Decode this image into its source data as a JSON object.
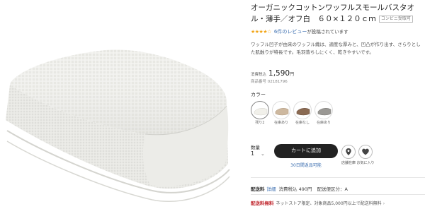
{
  "product": {
    "title": "オーガニックコットンワッフルスモールバスタオル・薄手／オフ白　６０×１２０ｃｍ",
    "conv_badge": "コンビニ受取可",
    "rating_stars": "★★★★☆",
    "rating_value": 3.5,
    "review_link": "6件のレビュー",
    "review_suffix": "が投稿されています",
    "description": "ワッフル凹子が由来のワッフル織は、適度な厚みと、凹凸が作り出す、さらりとした肌触りが特長です。毛羽落ちしにくく、乾きやすいです。",
    "price_label": "消費税込",
    "price_value": "1,590",
    "price_unit": "円",
    "sku": "商品番号 02181796"
  },
  "color": {
    "label": "カラー",
    "swatches": [
      {
        "caption": "残り2",
        "tone": "#f3f2ec",
        "selected": true
      },
      {
        "caption": "在庫あり",
        "tone": "#c9b49c",
        "selected": false
      },
      {
        "caption": "在庫なし",
        "tone": "#8a6a52",
        "selected": false
      },
      {
        "caption": "在庫あり",
        "tone": "#9a9894",
        "selected": false
      }
    ]
  },
  "purchase": {
    "qty_label": "数量",
    "qty_value": "1",
    "cart_button": "カートに追加",
    "points_link": "30日間返品可能",
    "store_stock": "店舗在庫",
    "favorite": "お気に入り"
  },
  "shipping": {
    "label": "配送料",
    "detail_link": "詳細",
    "fee": "消費税込 490円",
    "category": "配送便区分：A"
  },
  "free_shipping": {
    "label": "配送料無料",
    "text": "ネットストア限定、対象商品5,000円以上で配送料無料",
    "arrow": "›"
  },
  "colors": {
    "accent_dark": "#222222",
    "link": "#3d6fb0",
    "star": "#f2a516",
    "free_red": "#c0262d"
  }
}
